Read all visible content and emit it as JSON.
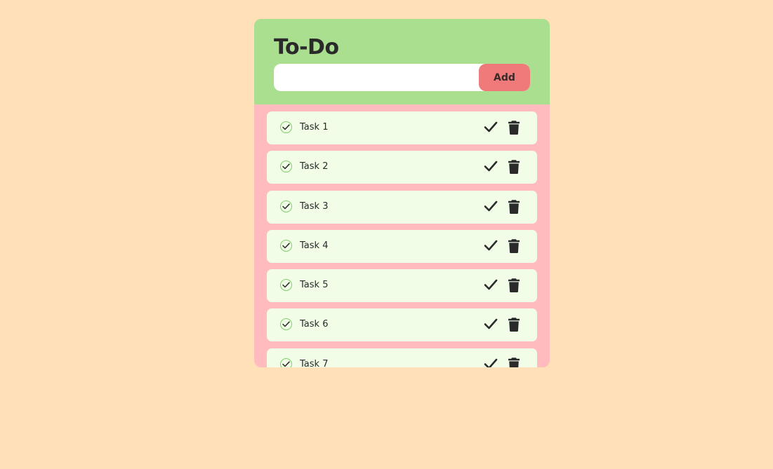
{
  "header": {
    "title": "To-Do",
    "input_value": "",
    "add_label": "Add"
  },
  "tasks": [
    {
      "label": "Task 1"
    },
    {
      "label": "Task 2"
    },
    {
      "label": "Task 3"
    },
    {
      "label": "Task 4"
    },
    {
      "label": "Task 5"
    },
    {
      "label": "Task 6"
    },
    {
      "label": "Task 7"
    }
  ],
  "icons": {
    "row_check": "check-circle-icon",
    "done": "checkmark-icon",
    "delete": "trash-icon"
  },
  "colors": {
    "page_background": "#ffe0b9",
    "header_background": "#a9df8f",
    "list_background": "#ffbbbd",
    "item_background": "#f1fde7",
    "add_button": "#ee7a7a",
    "text": "#2a2a2a"
  }
}
